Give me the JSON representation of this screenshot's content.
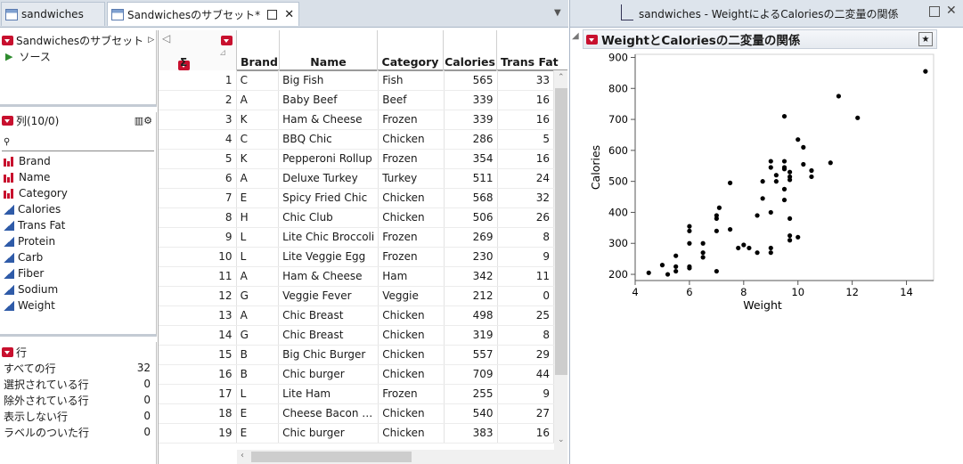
{
  "tabs": [
    {
      "label": "sandwiches"
    },
    {
      "label": "Sandwichesのサブセット*"
    }
  ],
  "report_tab": {
    "label": "sandwiches - WeightによるCaloriesの二変量の関係"
  },
  "table_panel": {
    "title": "Sandwichesのサブセット",
    "source_label": "ソース"
  },
  "columns_panel": {
    "title": "列(10/0)",
    "search_placeholder": "",
    "items": [
      {
        "label": "Brand",
        "type": "nominal"
      },
      {
        "label": "Name",
        "type": "nominal"
      },
      {
        "label": "Category",
        "type": "nominal"
      },
      {
        "label": "Calories",
        "type": "continuous"
      },
      {
        "label": "Trans Fat",
        "type": "continuous"
      },
      {
        "label": "Protein",
        "type": "continuous"
      },
      {
        "label": "Carb",
        "type": "continuous"
      },
      {
        "label": "Fiber",
        "type": "continuous"
      },
      {
        "label": "Sodium",
        "type": "continuous"
      },
      {
        "label": "Weight",
        "type": "continuous"
      }
    ]
  },
  "rows_panel": {
    "title": "行",
    "items": [
      {
        "label": "すべての行",
        "value": "32"
      },
      {
        "label": "選択されている行",
        "value": "0"
      },
      {
        "label": "除外されている行",
        "value": "0"
      },
      {
        "label": "表示しない行",
        "value": "0"
      },
      {
        "label": "ラベルのついた行",
        "value": "0"
      }
    ]
  },
  "grid": {
    "sigma": "Σ",
    "headers": [
      "Brand",
      "Name",
      "Category",
      "Calories",
      "Trans Fat"
    ],
    "rows": [
      [
        "1",
        "C",
        "Big Fish",
        "Fish",
        "565",
        "33"
      ],
      [
        "2",
        "A",
        "Baby Beef",
        "Beef",
        "339",
        "16"
      ],
      [
        "3",
        "K",
        "Ham & Cheese",
        "Frozen",
        "339",
        "16"
      ],
      [
        "4",
        "C",
        "BBQ Chic",
        "Chicken",
        "286",
        "5"
      ],
      [
        "5",
        "K",
        "Pepperoni Rollup",
        "Frozen",
        "354",
        "16"
      ],
      [
        "6",
        "A",
        "Deluxe Turkey",
        "Turkey",
        "511",
        "24"
      ],
      [
        "7",
        "E",
        "Spicy Fried Chic",
        "Chicken",
        "568",
        "32"
      ],
      [
        "8",
        "H",
        "Chic Club",
        "Chicken",
        "506",
        "26"
      ],
      [
        "9",
        "L",
        "Lite Chic Broccoli",
        "Frozen",
        "269",
        "8"
      ],
      [
        "10",
        "L",
        "Lite Veggie Egg",
        "Frozen",
        "230",
        "9"
      ],
      [
        "11",
        "A",
        "Ham & Cheese",
        "Ham",
        "342",
        "11"
      ],
      [
        "12",
        "G",
        "Veggie Fever",
        "Veggie",
        "212",
        "0"
      ],
      [
        "13",
        "A",
        "Chic Breast",
        "Chicken",
        "498",
        "25"
      ],
      [
        "14",
        "G",
        "Chic Breast",
        "Chicken",
        "319",
        "8"
      ],
      [
        "15",
        "B",
        "Big Chic Burger",
        "Chicken",
        "557",
        "29"
      ],
      [
        "16",
        "B",
        "Chic burger",
        "Chicken",
        "709",
        "44"
      ],
      [
        "17",
        "L",
        "Lite Ham",
        "Frozen",
        "255",
        "9"
      ],
      [
        "18",
        "E",
        "Cheese Bacon …",
        "Chicken",
        "540",
        "27"
      ],
      [
        "19",
        "E",
        "Chic burger",
        "Chicken",
        "383",
        "16"
      ]
    ]
  },
  "report": {
    "title": "WeightとCaloriesの二変量の関係"
  },
  "chart_data": {
    "type": "scatter",
    "title": "",
    "xlabel": "Weight",
    "ylabel": "Calories",
    "xlim": [
      4,
      15
    ],
    "ylim": [
      180,
      910
    ],
    "xticks": [
      4,
      6,
      8,
      10,
      12,
      14
    ],
    "yticks": [
      200,
      300,
      400,
      500,
      600,
      700,
      800,
      900
    ],
    "grid": false,
    "points": [
      [
        4.5,
        205
      ],
      [
        5.0,
        230
      ],
      [
        5.2,
        200
      ],
      [
        5.5,
        210
      ],
      [
        5.5,
        225
      ],
      [
        5.5,
        260
      ],
      [
        6.0,
        220
      ],
      [
        6.0,
        225
      ],
      [
        6.0,
        300
      ],
      [
        6.0,
        340
      ],
      [
        6.0,
        355
      ],
      [
        6.5,
        255
      ],
      [
        6.5,
        270
      ],
      [
        6.5,
        300
      ],
      [
        7.0,
        210
      ],
      [
        7.0,
        340
      ],
      [
        7.0,
        380
      ],
      [
        7.0,
        390
      ],
      [
        7.1,
        415
      ],
      [
        7.5,
        345
      ],
      [
        7.5,
        495
      ],
      [
        7.8,
        285
      ],
      [
        8.0,
        295
      ],
      [
        8.2,
        285
      ],
      [
        8.5,
        270
      ],
      [
        8.5,
        390
      ],
      [
        8.7,
        445
      ],
      [
        8.7,
        500
      ],
      [
        9.0,
        270
      ],
      [
        9.0,
        285
      ],
      [
        9.0,
        400
      ],
      [
        9.0,
        545
      ],
      [
        9.0,
        565
      ],
      [
        9.2,
        500
      ],
      [
        9.2,
        520
      ],
      [
        9.5,
        440
      ],
      [
        9.5,
        475
      ],
      [
        9.5,
        540
      ],
      [
        9.5,
        545
      ],
      [
        9.5,
        565
      ],
      [
        9.5,
        710
      ],
      [
        9.7,
        310
      ],
      [
        9.7,
        325
      ],
      [
        9.7,
        380
      ],
      [
        9.7,
        505
      ],
      [
        9.7,
        515
      ],
      [
        9.7,
        530
      ],
      [
        10.0,
        320
      ],
      [
        10.0,
        635
      ],
      [
        10.2,
        555
      ],
      [
        10.2,
        610
      ],
      [
        10.5,
        515
      ],
      [
        10.5,
        535
      ],
      [
        11.2,
        560
      ],
      [
        11.5,
        775
      ],
      [
        12.2,
        705
      ],
      [
        14.7,
        855
      ]
    ]
  }
}
